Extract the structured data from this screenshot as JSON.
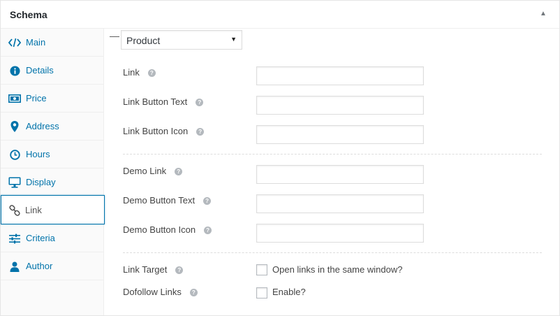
{
  "metabox": {
    "title": "Schema",
    "toggle_icon": "triangle-up"
  },
  "sidebar": {
    "tabs": [
      {
        "label": "Main",
        "icon": "code-icon"
      },
      {
        "label": "Details",
        "icon": "info-icon"
      },
      {
        "label": "Price",
        "icon": "money-icon"
      },
      {
        "label": "Address",
        "icon": "location-pin-icon"
      },
      {
        "label": "Hours",
        "icon": "clock-icon"
      },
      {
        "label": "Display",
        "icon": "desktop-icon"
      },
      {
        "label": "Link",
        "icon": "chain-link-icon",
        "active": true
      },
      {
        "label": "Criteria",
        "icon": "sliders-icon"
      },
      {
        "label": "Author",
        "icon": "user-icon"
      }
    ]
  },
  "content": {
    "type_select": {
      "value": "Product"
    },
    "fields": [
      {
        "label": "Link",
        "value": ""
      },
      {
        "label": "Link Button Text",
        "value": ""
      },
      {
        "label": "Link Button Icon",
        "value": ""
      },
      {
        "label": "Demo Link",
        "value": ""
      },
      {
        "label": "Demo Button Text",
        "value": ""
      },
      {
        "label": "Demo Button Icon",
        "value": ""
      }
    ],
    "checkboxes": [
      {
        "label": "Link Target",
        "option": "Open links in the same window?",
        "checked": false
      },
      {
        "label": "Dofollow Links",
        "option": "Enable?",
        "checked": false
      }
    ],
    "help_glyph": "?"
  },
  "colors": {
    "accent": "#0073aa",
    "help_icon": "#b4b9be",
    "border": "#dddddd"
  }
}
